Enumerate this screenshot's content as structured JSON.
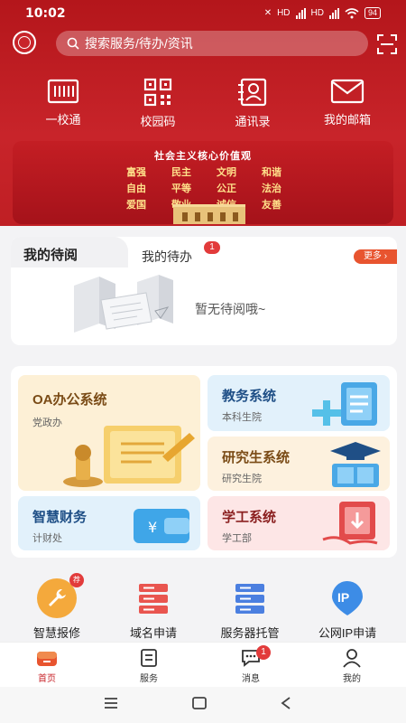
{
  "status_bar": {
    "time": "10:02",
    "battery": "94",
    "network_1": "HD",
    "network_2": "HD"
  },
  "search": {
    "placeholder": "搜索服务/待办/资讯"
  },
  "quick_actions": [
    {
      "label": "一校通",
      "icon": "card-icon"
    },
    {
      "label": "校园码",
      "icon": "qr-code-icon"
    },
    {
      "label": "通讯录",
      "icon": "contacts-icon"
    },
    {
      "label": "我的邮箱",
      "icon": "mail-icon"
    }
  ],
  "banner": {
    "title": "社会主义核心价值观",
    "values": [
      "富强",
      "民主",
      "文明",
      "和谐",
      "自由",
      "平等",
      "公正",
      "法治",
      "爱国",
      "敬业",
      "诚信",
      "友善"
    ]
  },
  "pending": {
    "tab_active": "我的待阅",
    "tab_other": "我的待办",
    "tab_other_badge": "1",
    "more_label": "更多",
    "empty_text": "暂无待阅哦~"
  },
  "systems": [
    {
      "title": "OA办公系统",
      "subtitle": "党政办",
      "bg": "#fdf0d6",
      "title_color": "#7a4b16"
    },
    {
      "title": "教务系统",
      "subtitle": "本科生院",
      "bg": "#e2f1fb",
      "title_color": "#1f4f86"
    },
    {
      "title": "研究生系统",
      "subtitle": "研究生院",
      "bg": "#fdf1de",
      "title_color": "#7a4b16"
    },
    {
      "title": "智慧财务",
      "subtitle": "计财处",
      "bg": "#e2f1fb",
      "title_color": "#1f4f86"
    },
    {
      "title": "学工系统",
      "subtitle": "学工部",
      "bg": "#fde6e6",
      "title_color": "#8a1f1f"
    }
  ],
  "services": [
    {
      "label": "智慧报修",
      "icon": "wrench-icon",
      "badge": "荐"
    },
    {
      "label": "域名申请",
      "icon": "server-rack-icon"
    },
    {
      "label": "服务器托管",
      "icon": "server-icon"
    },
    {
      "label": "公网IP申请",
      "icon": "ip-icon"
    }
  ],
  "tabbar": [
    {
      "label": "首页",
      "icon": "home-icon"
    },
    {
      "label": "服务",
      "icon": "service-icon"
    },
    {
      "label": "消息",
      "icon": "message-icon",
      "badge": "1"
    },
    {
      "label": "我的",
      "icon": "profile-icon"
    }
  ],
  "colors": {
    "primary": "#c8242a",
    "accent": "#e8542f",
    "badge": "#e23b3b"
  }
}
